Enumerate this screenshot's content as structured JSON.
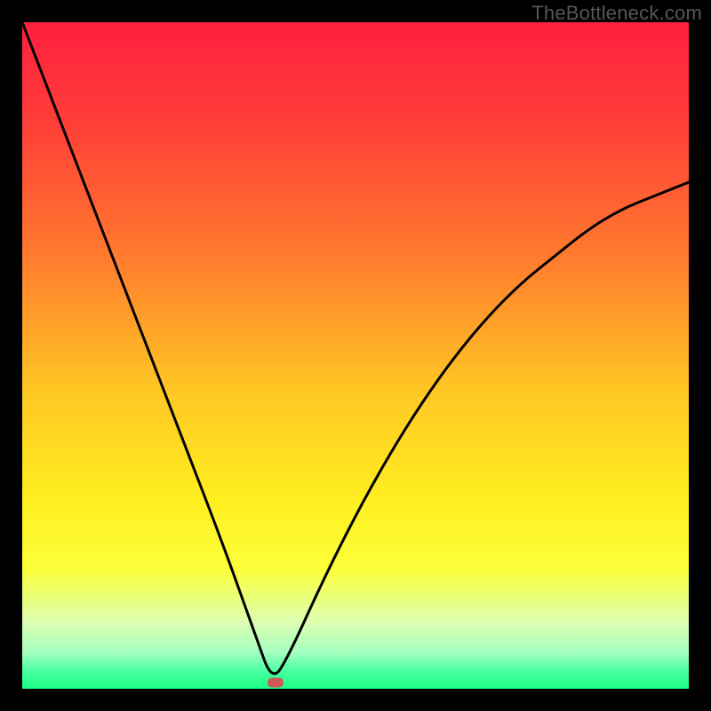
{
  "attribution": "TheBottleneck.com",
  "chart_data": {
    "type": "line",
    "title": "",
    "xlabel": "",
    "ylabel": "",
    "xlim": [
      0,
      100
    ],
    "ylim": [
      0,
      100
    ],
    "series": [
      {
        "name": "bottleneck-curve",
        "x": [
          0,
          5,
          10,
          15,
          20,
          25,
          30,
          35,
          37.5,
          40,
          45,
          50,
          55,
          60,
          65,
          70,
          75,
          80,
          85,
          90,
          95,
          100
        ],
        "values": [
          100,
          87,
          74,
          61,
          48,
          35,
          22,
          8,
          1,
          5,
          16,
          26,
          35,
          43,
          50,
          56,
          61,
          65,
          69,
          72,
          74,
          76
        ]
      }
    ],
    "marker": {
      "x": 38,
      "y": 1,
      "color": "#cf5859"
    },
    "gradient_stops": [
      {
        "offset": 0,
        "color": "#ff1f3f"
      },
      {
        "offset": 0.15,
        "color": "#ff3e38"
      },
      {
        "offset": 0.35,
        "color": "#ff7a2e"
      },
      {
        "offset": 0.55,
        "color": "#ffc624"
      },
      {
        "offset": 0.72,
        "color": "#ffef20"
      },
      {
        "offset": 0.82,
        "color": "#fbff3a"
      },
      {
        "offset": 0.9,
        "color": "#dcffb0"
      },
      {
        "offset": 0.945,
        "color": "#a6ffc0"
      },
      {
        "offset": 0.975,
        "color": "#44ffa0"
      },
      {
        "offset": 1.0,
        "color": "#1dff85"
      }
    ]
  }
}
